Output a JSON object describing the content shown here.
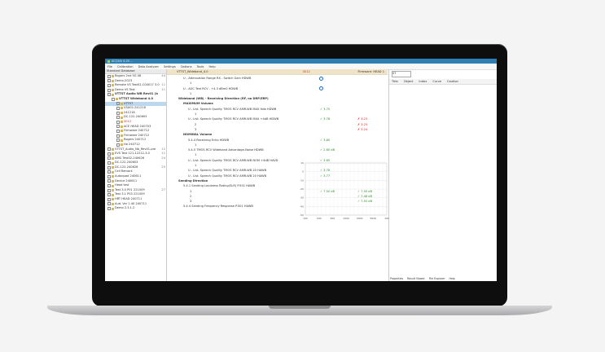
{
  "app": {
    "title": "ACQUA 4.20 ...",
    "menu": [
      "File",
      "Calibration",
      "Data Analyzer",
      "Settings",
      "Options",
      "Tools",
      "Help"
    ]
  },
  "left": {
    "header": "Standard Database",
    "items": [
      {
        "label": "Rogers 2nd 5G 08",
        "num": "44"
      },
      {
        "label": "Demo-2023",
        "num": ""
      },
      {
        "label": "Remote VS Test02-C04017 3.0",
        "num": "11"
      },
      {
        "label": "Demo VS Test",
        "num": "11"
      },
      {
        "label": "VTTST Audio WB Rev01 (b",
        "num": ""
      },
      {
        "label": "VTTST Wideband 4.0",
        "num": ""
      },
      {
        "label": "VTTST",
        "num": "",
        "sel": true
      },
      {
        "label": "VSA02-241218",
        "num": ""
      },
      {
        "label": "241218",
        "num": ""
      },
      {
        "label": "DC-122-240603",
        "num": ""
      },
      {
        "label": "3012",
        "num": "",
        "red": true
      },
      {
        "label": "ACE HEAD 240703",
        "num": ""
      },
      {
        "label": "Firmware 240712",
        "num": ""
      },
      {
        "label": "Firmware 240712",
        "num": ""
      },
      {
        "label": "Rogers 240712",
        "num": ""
      },
      {
        "label": "Ho 240712",
        "num": ""
      },
      {
        "label": "VTTST_Audio_Nb_Rev01-pre",
        "num": "12"
      },
      {
        "label": "EVS Test 121-12212-3.0",
        "num": "11"
      },
      {
        "label": "AMG Test02-240626",
        "num": "24"
      },
      {
        "label": "DC-122-240603",
        "num": ""
      },
      {
        "label": "DC-122-240628",
        "num": "25"
      },
      {
        "label": "Cell Remark",
        "num": ""
      },
      {
        "label": "Autoquad 240611",
        "num": ""
      },
      {
        "label": "Device 240611",
        "num": ""
      },
      {
        "label": "Head test",
        "num": ""
      },
      {
        "label": "Test 3.0 P01 221009",
        "num": "27"
      },
      {
        "label": "Test 3.1 P03 221009",
        "num": ""
      },
      {
        "label": "HRT HEAD 240711",
        "num": ""
      },
      {
        "label": "Aud. Ver 1.40 240711",
        "num": ""
      },
      {
        "label": "Demo 2.3.1.2",
        "num": ""
      }
    ]
  },
  "middle": {
    "tab": "VTTST_Wideband_4.0",
    "tab_red": "3012",
    "tab_right": "Firmware: HEAD 1",
    "rows": [
      {
        "t": "U - Attenuation Range RX - Switch Gain HDWB",
        "ind": 20,
        "circle": true
      },
      {
        "t": "1",
        "ind": 28
      },
      {
        "t": "U - AGC Test RCV - +4.3 dBm0 HDWB",
        "ind": 20,
        "circle": true
      },
      {
        "t": "1",
        "ind": 28
      },
      {
        "t": "Wideband (WB) - Receiving Direction (RF, no DRP/ERP)",
        "ind": 14,
        "bold": true
      },
      {
        "t": "MAXIMUM Volume",
        "ind": 20,
        "bold": true
      },
      {
        "t": "U - List. Speech Quality TMOS RCV AMR-WB MAX Hdb HDWB",
        "ind": 26,
        "r1": "3.75",
        "r1c": "ok"
      },
      {
        "t": "1",
        "ind": 34
      },
      {
        "t": "U - List. Speech Quality TMOS RCV AMR-WB MAX +4dB HDWB",
        "ind": 26,
        "r1": "3.78",
        "r1c": "ok",
        "r2": "3.23",
        "r2c": "bad"
      },
      {
        "t": "2",
        "ind": 34,
        "r2": "3.25",
        "r2c": "bad"
      },
      {
        "t": "3",
        "ind": 34,
        "r2": "3.24",
        "r2c": "bad"
      },
      {
        "t": "NOMINAL Volume",
        "ind": 20,
        "bold": true
      },
      {
        "t": "5.4.4 Receiving Echo HDWB",
        "ind": 26,
        "r1": "3.80",
        "r1c": "ok"
      },
      {
        "t": "1",
        "ind": 34
      },
      {
        "t": "5.4.5 TMOS RCV Wideband Advantage-Noise HDWB",
        "ind": 26,
        "r1": "2.60 dB",
        "r1c": "ok"
      },
      {
        "t": "1",
        "ind": 34
      },
      {
        "t": "U - List. Speech Quality TMOS RCV AMR-WB NOM +4dB HAVD",
        "ind": 26,
        "r1": "3.65",
        "r1c": "ok"
      },
      {
        "t": "1",
        "ind": 34
      },
      {
        "t": "U - List. Speech Quality TMOS RCV AMR-WB 20 HAWB",
        "ind": 26,
        "r1": "3.78",
        "r1c": "ok"
      },
      {
        "t": "U - List. Speech Quality TMOS RCV AMR-WB 20 HAWB",
        "ind": 26,
        "r1": "3.77",
        "r1c": "ok"
      },
      {
        "t": "Sending Direction",
        "ind": 14,
        "bold": true
      },
      {
        "t": "5.4.1 Sending Loudness Rating(SLR) P.501 HAWB",
        "ind": 20
      },
      {
        "t": "1",
        "ind": 28,
        "r1": "7.50 dB",
        "r1c": "ok",
        "r2": "7.50 dB",
        "r2c": "ok"
      },
      {
        "t": "2",
        "ind": 28,
        "r2": "7.48 dB",
        "r2c": "ok"
      },
      {
        "t": "3",
        "ind": 28,
        "r2": "7.55 dB",
        "r2c": "ok"
      },
      {
        "t": "5.4.4 Sending Frequency Response P.501 HAWB",
        "ind": 20
      }
    ]
  },
  "right": {
    "dropdown": "ST",
    "cols": [
      "Title",
      "Object",
      "Index",
      "Curve",
      "Caution"
    ],
    "chart_data": {
      "type": "line",
      "xlabel": "",
      "ylabel": "",
      "yticks": [
        "10",
        "0",
        "-10",
        "-20",
        "-30",
        "-40",
        "-50"
      ],
      "xticks": [
        "100",
        "200",
        "500",
        "1000",
        "2000",
        "5000",
        "10k"
      ],
      "series": []
    },
    "bottom_tabs": [
      "Properties",
      "Result Viewer",
      "File Explorer",
      "Help"
    ]
  },
  "colors": {
    "title": "#2d7fb3",
    "select": "#bcd8ef",
    "ok": "#2a8a2a",
    "bad": "#d22222"
  }
}
